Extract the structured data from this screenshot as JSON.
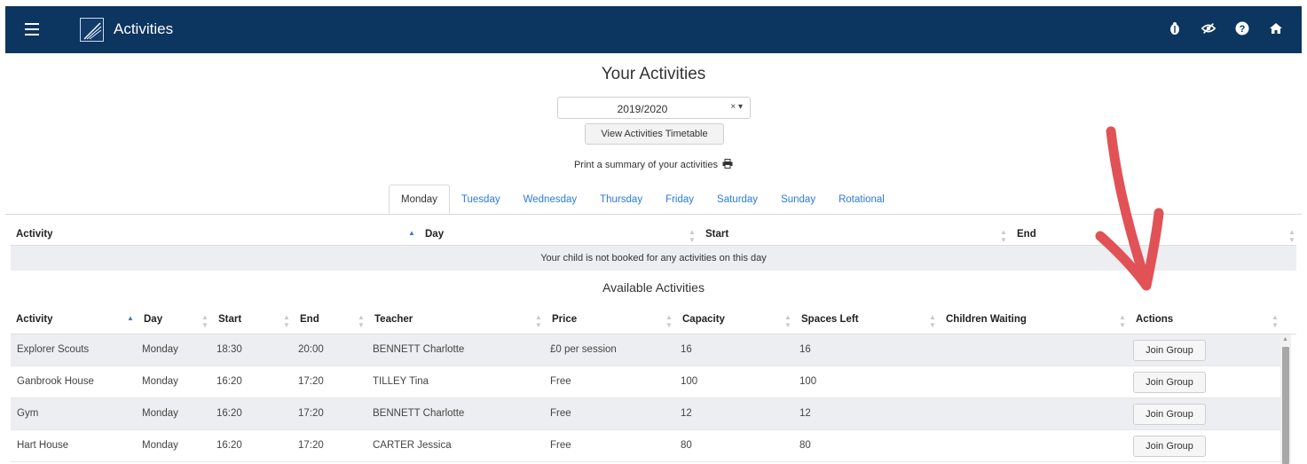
{
  "header": {
    "title": "Activities"
  },
  "page": {
    "title": "Your Activities",
    "year_select": {
      "value": "2019/2020",
      "clear": "×",
      "caret": "▾"
    },
    "timetable_button": "View Activities Timetable",
    "print_text": "Print a summary of your activities"
  },
  "tabs": [
    {
      "label": "Monday",
      "active": true
    },
    {
      "label": "Tuesday"
    },
    {
      "label": "Wednesday"
    },
    {
      "label": "Thursday"
    },
    {
      "label": "Friday"
    },
    {
      "label": "Saturday"
    },
    {
      "label": "Sunday"
    },
    {
      "label": "Rotational"
    }
  ],
  "booked": {
    "columns": [
      "Activity",
      "Day",
      "Start",
      "End"
    ],
    "empty_message": "Your child is not booked for any activities on this day"
  },
  "available": {
    "title": "Available Activities",
    "columns": [
      "Activity",
      "Day",
      "Start",
      "End",
      "Teacher",
      "Price",
      "Capacity",
      "Spaces Left",
      "Children Waiting",
      "Actions"
    ],
    "rows": [
      {
        "activity": "Explorer Scouts",
        "day": "Monday",
        "start": "18:30",
        "end": "20:00",
        "teacher": "BENNETT Charlotte",
        "price": "£0 per session",
        "capacity": "16",
        "spaces_left": "16",
        "children_waiting": "",
        "action": "Join Group"
      },
      {
        "activity": "Ganbrook House",
        "day": "Monday",
        "start": "16:20",
        "end": "17:20",
        "teacher": "TILLEY Tina",
        "price": "Free",
        "capacity": "100",
        "spaces_left": "100",
        "children_waiting": "",
        "action": "Join Group"
      },
      {
        "activity": "Gym",
        "day": "Monday",
        "start": "16:20",
        "end": "17:20",
        "teacher": "BENNETT Charlotte",
        "price": "Free",
        "capacity": "12",
        "spaces_left": "12",
        "children_waiting": "",
        "action": "Join Group"
      },
      {
        "activity": "Hart House",
        "day": "Monday",
        "start": "16:20",
        "end": "17:20",
        "teacher": "CARTER Jessica",
        "price": "Free",
        "capacity": "80",
        "spaces_left": "80",
        "children_waiting": "",
        "action": "Join Group"
      }
    ]
  },
  "icons": {
    "nav": [
      "bug-icon",
      "eye-slash-icon",
      "help-icon",
      "home-icon"
    ],
    "print": "printer-icon"
  },
  "colors": {
    "topbar": "#0c3560",
    "link": "#2a7ae2",
    "annotation_arrow": "#e05256",
    "row_shade": "#eceef1"
  }
}
